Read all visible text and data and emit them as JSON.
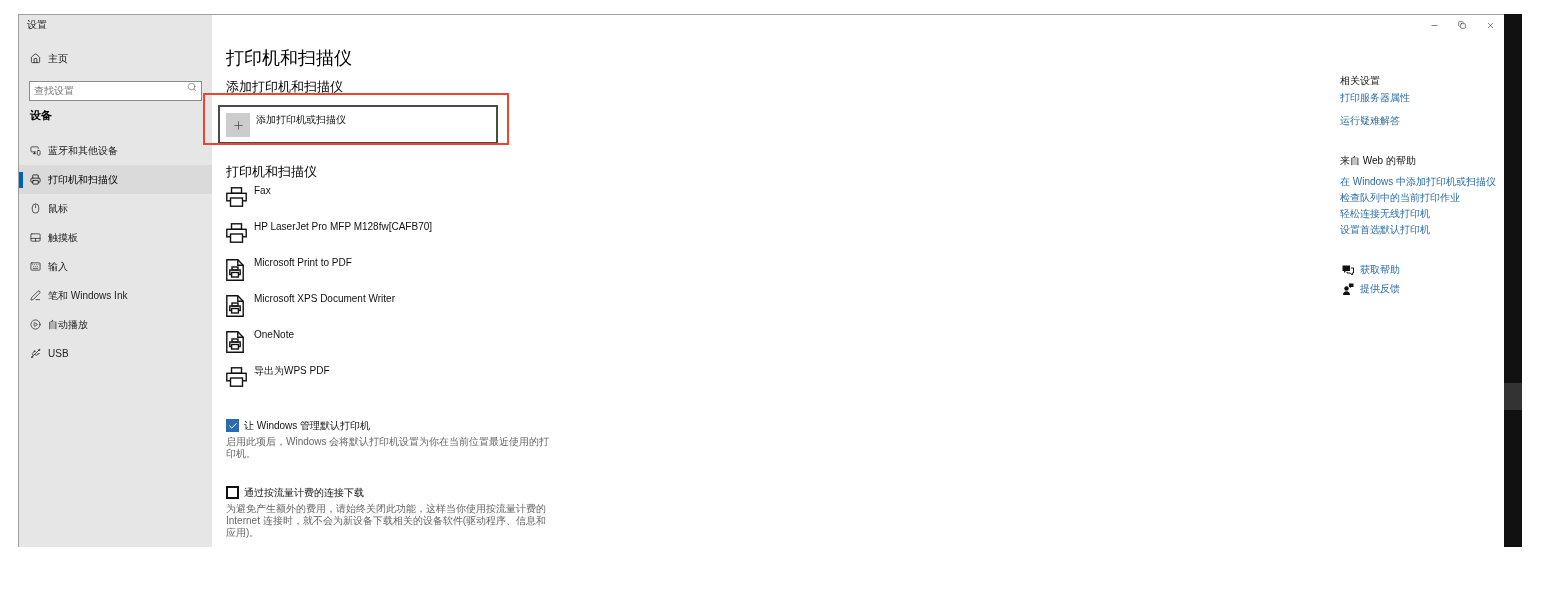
{
  "window": {
    "title": "设置"
  },
  "sidebar": {
    "home": "主页",
    "search": {
      "placeholder": "查找设置"
    },
    "section": "设备",
    "items": [
      {
        "label": "蓝牙和其他设备",
        "selected": false
      },
      {
        "label": "打印机和扫描仪",
        "selected": true
      },
      {
        "label": "鼠标",
        "selected": false
      },
      {
        "label": "触摸板",
        "selected": false
      },
      {
        "label": "输入",
        "selected": false
      },
      {
        "label": "笔和 Windows Ink",
        "selected": false
      },
      {
        "label": "自动播放",
        "selected": false
      },
      {
        "label": "USB",
        "selected": false
      }
    ]
  },
  "page": {
    "title": "打印机和扫描仪",
    "add_section": {
      "heading": "添加打印机和扫描仪",
      "add_button": {
        "label": "添加打印机或扫描仪",
        "highlighted": true
      }
    },
    "printers_section": {
      "heading": "打印机和扫描仪",
      "printers": [
        {
          "name": "Fax",
          "kind": "printer"
        },
        {
          "name": "HP LaserJet Pro MFP M128fw[CAFB70]",
          "kind": "printer"
        },
        {
          "name": "Microsoft Print to PDF",
          "kind": "document"
        },
        {
          "name": "Microsoft XPS Document Writer",
          "kind": "document"
        },
        {
          "name": "OneNote",
          "kind": "document"
        },
        {
          "name": "导出为WPS PDF",
          "kind": "printer"
        }
      ]
    },
    "options": [
      {
        "label": "让 Windows 管理默认打印机",
        "checked": true,
        "description": "启用此项后，Windows 会将默认打印机设置为你在当前位置最近使用的打印机。"
      },
      {
        "label": "通过按流量计费的连接下载",
        "checked": false,
        "description": "为避免产生额外的费用，请始终关闭此功能，这样当你使用按流量计费的 Internet 连接时，就不会为新设备下载相关的设备软件(驱动程序、信息和应用)。"
      }
    ]
  },
  "related": {
    "heading": "相关设置",
    "links": [
      "打印服务器属性",
      "运行疑难解答"
    ]
  },
  "web_help": {
    "heading": "来自 Web 的帮助",
    "links": [
      "在 Windows 中添加打印机或扫描仪",
      "检查队列中的当前打印作业",
      "轻松连接无线打印机",
      "设置首选默认打印机"
    ]
  },
  "support": [
    {
      "label": "获取帮助"
    },
    {
      "label": "提供反馈"
    }
  ]
}
